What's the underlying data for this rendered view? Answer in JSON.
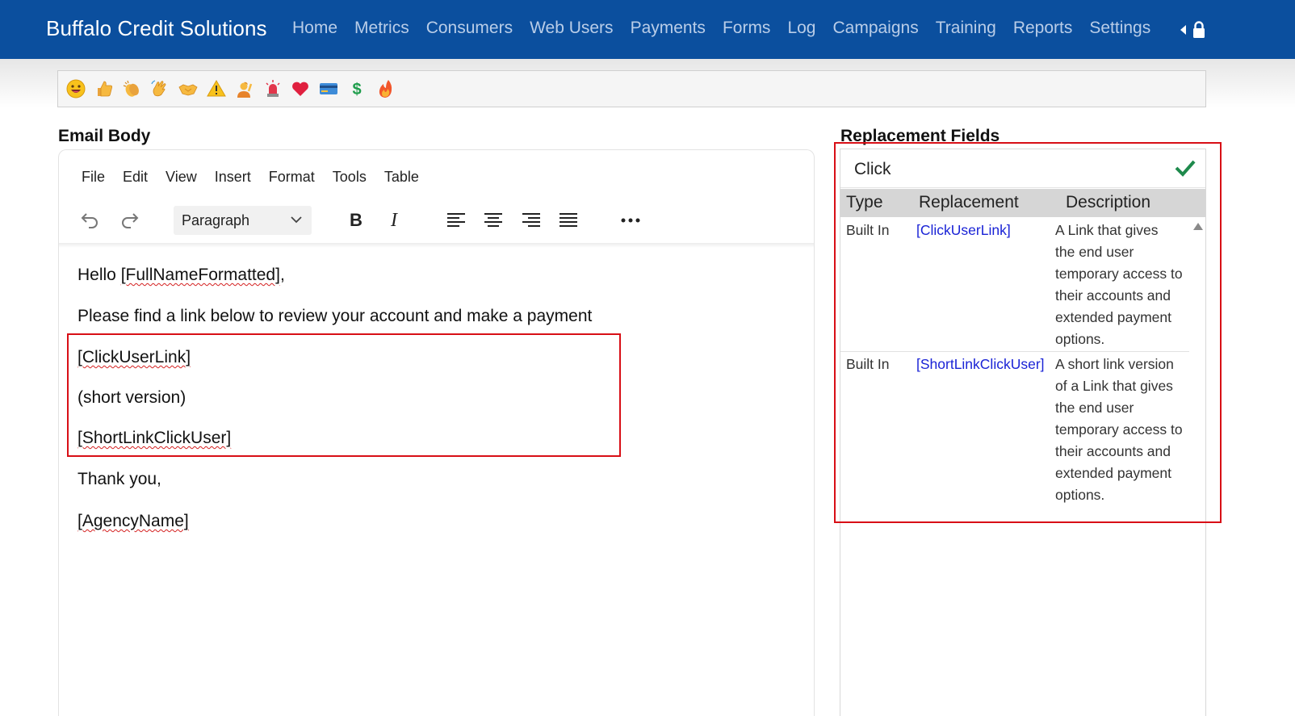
{
  "navbar": {
    "brand": "Buffalo Credit Solutions",
    "links": [
      "Home",
      "Metrics",
      "Consumers",
      "Web Users",
      "Payments",
      "Forms",
      "Log",
      "Campaigns",
      "Training",
      "Reports",
      "Settings"
    ],
    "right_icons": [
      "collapse-caret-icon",
      "lock-icon"
    ],
    "bg_color": "#0b4f9e"
  },
  "emoji_bar": {
    "emojis": [
      "grinning-face",
      "thumbs-up",
      "clapping-hands",
      "waving-hand",
      "handshake",
      "warning",
      "person-raising-hand",
      "police-light",
      "red-heart",
      "credit-card",
      "dollar-sign",
      "fire"
    ]
  },
  "email_body": {
    "title": "Email Body",
    "menu": [
      "File",
      "Edit",
      "View",
      "Insert",
      "Format",
      "Tools",
      "Table"
    ],
    "toolbar": {
      "block_format": "Paragraph",
      "buttons": [
        "undo",
        "redo",
        "bold",
        "italic",
        "align-left",
        "align-center",
        "align-right",
        "justify",
        "more"
      ]
    },
    "lines": {
      "greeting_prefix": "Hello ",
      "greeting_token": "[FullNameFormatted]",
      "greeting_suffix": ",",
      "intro": "Please find a link below to review your account and make a payment",
      "click_link": "[ClickUserLink]",
      "short_note": "(short version)",
      "short_link": "[ShortLinkClickUser]",
      "thanks": "Thank you,",
      "agency": "[AgencyName]"
    }
  },
  "replacement_fields": {
    "title": "Replacement Fields",
    "search_value": "Click",
    "columns": [
      "Type",
      "Replacement",
      "Description"
    ],
    "rows": [
      {
        "type": "Built In",
        "replacement": "[ClickUserLink]",
        "description_lines": [
          "A Link that gives",
          "the end user",
          "temporary access to",
          "their accounts and",
          "extended payment",
          "options."
        ]
      },
      {
        "type": "Built In",
        "replacement": "[ShortLinkClickUser]",
        "description_lines": [
          "A short link version",
          "of a Link that gives",
          "the end user",
          "temporary access to",
          "their accounts and",
          "extended payment",
          "options."
        ]
      }
    ]
  },
  "colors": {
    "highlight_red": "#d80f16",
    "link_blue": "#1a23d6",
    "check_green": "#1e8a4c"
  }
}
